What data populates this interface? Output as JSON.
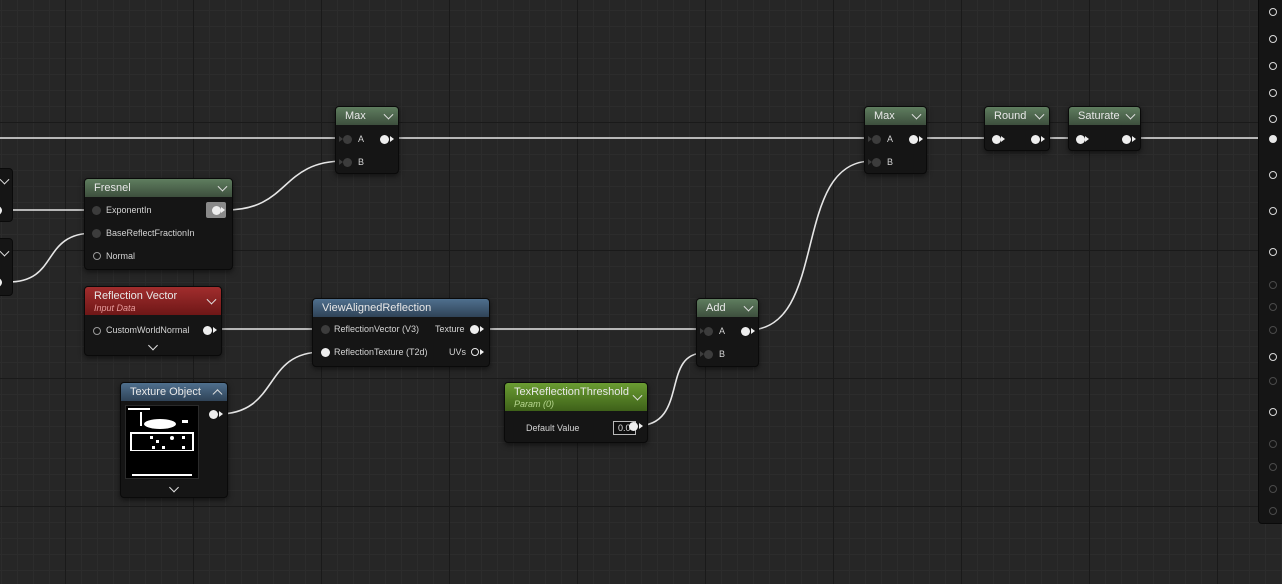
{
  "nodes": {
    "max1": {
      "title": "Max",
      "in_a": "A",
      "in_b": "B"
    },
    "max2": {
      "title": "Max",
      "in_a": "A",
      "in_b": "B"
    },
    "round": {
      "title": "Round"
    },
    "saturate": {
      "title": "Saturate"
    },
    "fresnel": {
      "title": "Fresnel",
      "in_exponent": "ExponentIn",
      "in_basereflect": "BaseReflectFractionIn",
      "in_normal": "Normal"
    },
    "reflection_vector": {
      "title": "Reflection Vector",
      "subtitle": "Input Data",
      "out_customworldnormal": "CustomWorldNormal"
    },
    "texture_object": {
      "title": "Texture Object"
    },
    "view_aligned_reflection": {
      "title": "ViewAlignedReflection",
      "in_reflection_vector": "ReflectionVector (V3)",
      "in_reflection_texture": "ReflectionTexture (T2d)",
      "out_texture": "Texture",
      "out_uvs": "UVs"
    },
    "add": {
      "title": "Add",
      "in_a": "A",
      "in_b": "B"
    },
    "tex_reflection_threshold": {
      "title": "TexReflectionThreshold",
      "subtitle": "Param (0)",
      "default_label": "Default Value",
      "default_value": "0.0"
    }
  },
  "colors": {
    "background": "#262626",
    "node_body": "#151515",
    "header_math": "#5f7d5f",
    "header_input": "#a12d2d",
    "header_texture": "#4f6f8d",
    "header_param": "#6a9c32",
    "wire": "#e6e6e6"
  },
  "icons": [
    "chevron-down-icon",
    "chevron-up-icon",
    "pin-connected-icon",
    "pin-disconnected-icon",
    "pin-output-arrow-icon"
  ]
}
